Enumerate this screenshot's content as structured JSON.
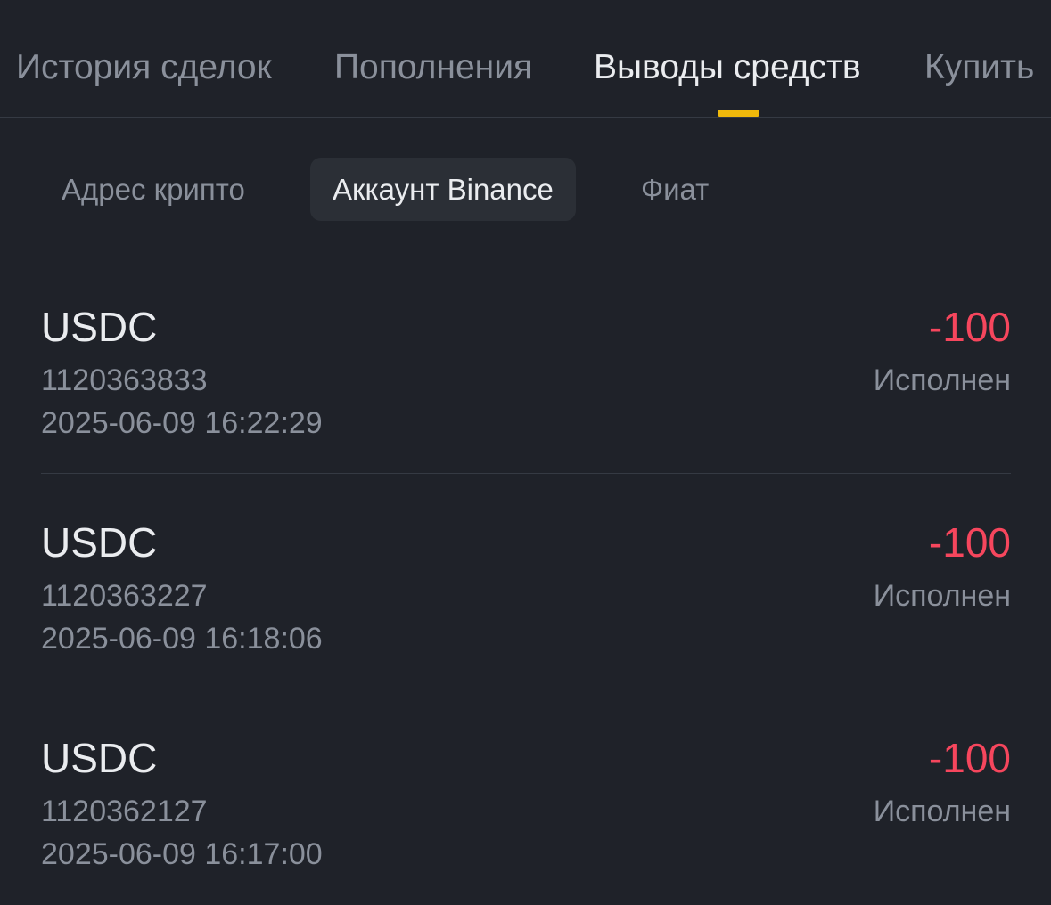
{
  "top_tabs": [
    {
      "label": "История сделок"
    },
    {
      "label": "Пополнения"
    },
    {
      "label": "Выводы средств"
    },
    {
      "label": "Купить"
    }
  ],
  "sub_tabs": [
    {
      "label": "Адрес крипто"
    },
    {
      "label": "Аккаунт Binance"
    },
    {
      "label": "Фиат"
    }
  ],
  "withdrawals": [
    {
      "asset": "USDC",
      "txid": "1120363833",
      "time": "2025-06-09 16:22:29",
      "amount": "-100",
      "status": "Исполнен"
    },
    {
      "asset": "USDC",
      "txid": "1120363227",
      "time": "2025-06-09 16:18:06",
      "amount": "-100",
      "status": "Исполнен"
    },
    {
      "asset": "USDC",
      "txid": "1120362127",
      "time": "2025-06-09 16:17:00",
      "amount": "-100",
      "status": "Исполнен"
    }
  ],
  "colors": {
    "background": "#1f2229",
    "accent": "#f0b90b",
    "negative": "#f6465d",
    "muted_text": "#8a909b",
    "primary_text": "#eaecef"
  }
}
